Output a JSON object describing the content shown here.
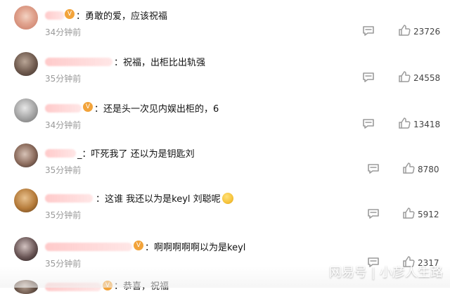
{
  "comments": [
    {
      "text": "：勇敢的爱，应该祝福",
      "time": "34分钟前",
      "likes": "23726"
    },
    {
      "text": "：祝福，出柜比出轨强",
      "time": "35分钟前",
      "likes": "24558"
    },
    {
      "text": "：还是头一次见内娱出柜的，6",
      "time": "34分钟前",
      "likes": "13418"
    },
    {
      "text": "_：吓死我了 还以为是钥匙刘",
      "time": "35分钟前",
      "likes": "8780"
    },
    {
      "text": "：这谁 我还以为是keyl 刘聪呢",
      "time": "35分钟前",
      "likes": "5912"
    },
    {
      "text": "：啊啊啊啊啊以为是keyl",
      "time": "35分钟前",
      "likes": "2317"
    }
  ],
  "partial_comment": {
    "text": "：恭喜，祝福"
  },
  "watermark": {
    "brand": "网易号",
    "account": "小彦人生路"
  },
  "icons": {
    "reply": "reply-icon",
    "like": "thumbs-up-icon",
    "vip": "vip-badge-icon",
    "emoji": "emoji-icon"
  }
}
